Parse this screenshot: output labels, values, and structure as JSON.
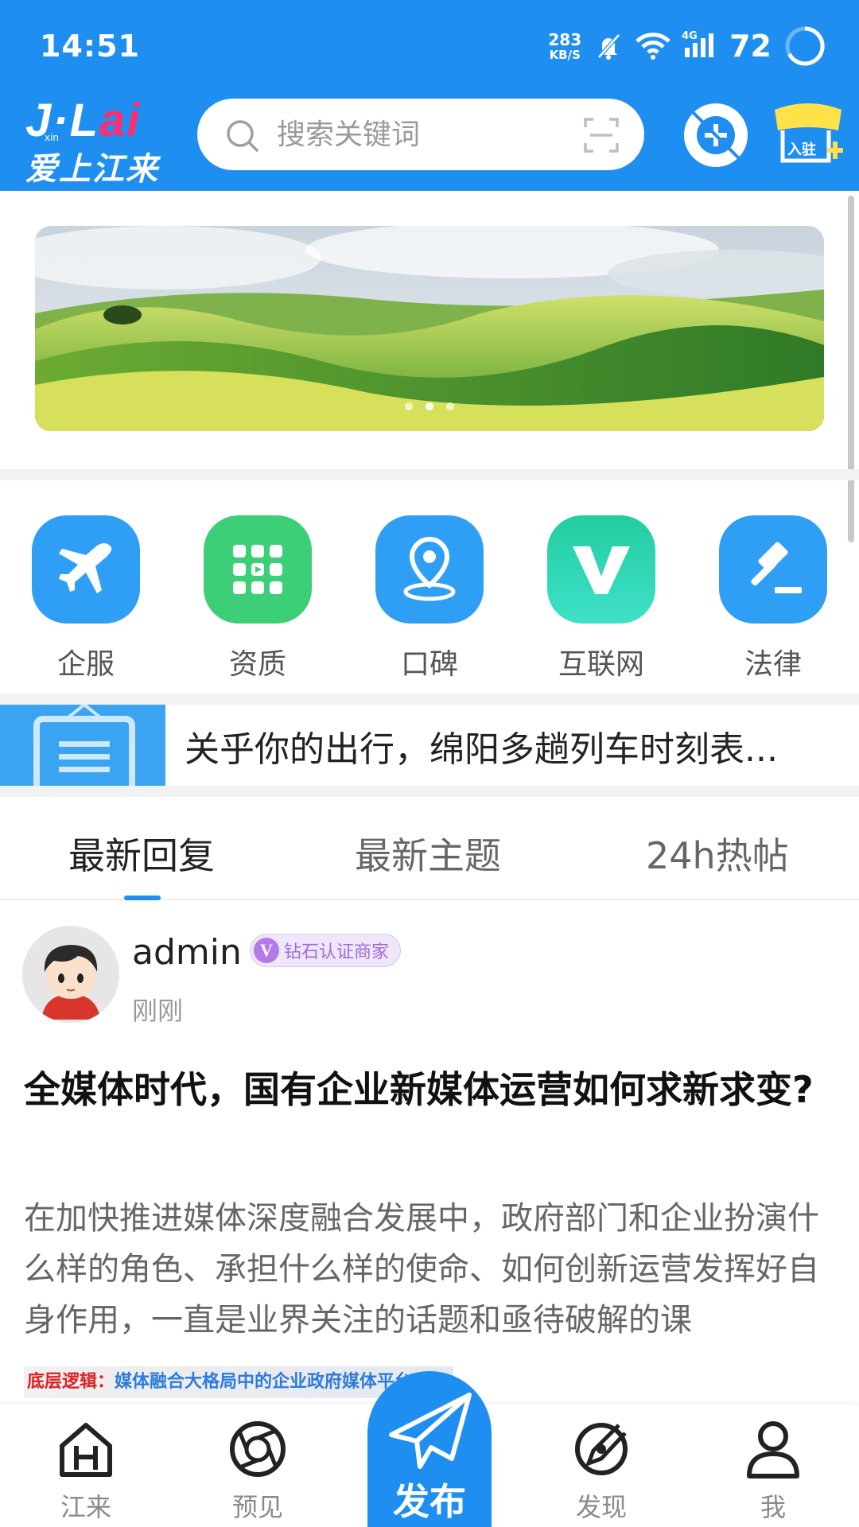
{
  "status_bar": {
    "time": "14:51",
    "net_speed_value": "283",
    "net_speed_unit": "KB/S",
    "network_type": "4G",
    "battery": "72",
    "icons": [
      "notification-muted-icon",
      "wifi-icon",
      "signal-icon",
      "battery-ring-icon"
    ]
  },
  "app_bar": {
    "logo_top": "J·L",
    "logo_top_accent": "ai",
    "logo_sub": "xin",
    "logo_bottom": "爱上江来",
    "search_placeholder": "搜索关键词",
    "icons": [
      "search-icon",
      "scan-icon",
      "add-icon",
      "shop-icon"
    ],
    "shop_badge": "入驻",
    "brand_color": "#1e8ff0"
  },
  "banner": {
    "dot_count": 3,
    "active_dot": 2
  },
  "quick_menu": [
    {
      "label": "企服",
      "icon": "plane-icon",
      "color": "#2f9ff5"
    },
    {
      "label": "资质",
      "icon": "grid-icon",
      "color": "#3ccf78"
    },
    {
      "label": "口碑",
      "icon": "location-icon",
      "color": "#2f9ff5"
    },
    {
      "label": "互联网",
      "icon": "v-icon",
      "color": "#2fd6b4"
    },
    {
      "label": "法律",
      "icon": "gavel-icon",
      "color": "#2f9ff5"
    }
  ],
  "notice": {
    "text": "关乎你的出行，绵阳多趟列车时刻表..."
  },
  "tabs": [
    {
      "label": "最新回复",
      "active": true
    },
    {
      "label": "最新主题",
      "active": false
    },
    {
      "label": "24h热帖",
      "active": false
    }
  ],
  "post": {
    "author": "admin",
    "badge": "钻石认证商家",
    "badge_letter": "V",
    "time": "刚刚",
    "title": "全媒体时代，国有企业新媒体运营如何求新求变?",
    "excerpt": "在加快推进媒体深度融合发展中，政府部门和企业扮演什么样的角色、承担什么样的使命、如何创新运营发挥好自身作用，一直是业界关注的话题和亟待破解的课",
    "image_caption_highlight": "底层逻辑：",
    "image_caption_rest": "媒体融合大格局中的企业政府媒体平台"
  },
  "bottom_nav": [
    {
      "label": "江来",
      "icon": "home-icon"
    },
    {
      "label": "预见",
      "icon": "aperture-icon"
    },
    {
      "label": "发现",
      "icon": "compass-icon"
    },
    {
      "label": "我",
      "icon": "user-icon"
    }
  ],
  "publish": {
    "label": "发布",
    "icon": "paper-plane-icon"
  }
}
